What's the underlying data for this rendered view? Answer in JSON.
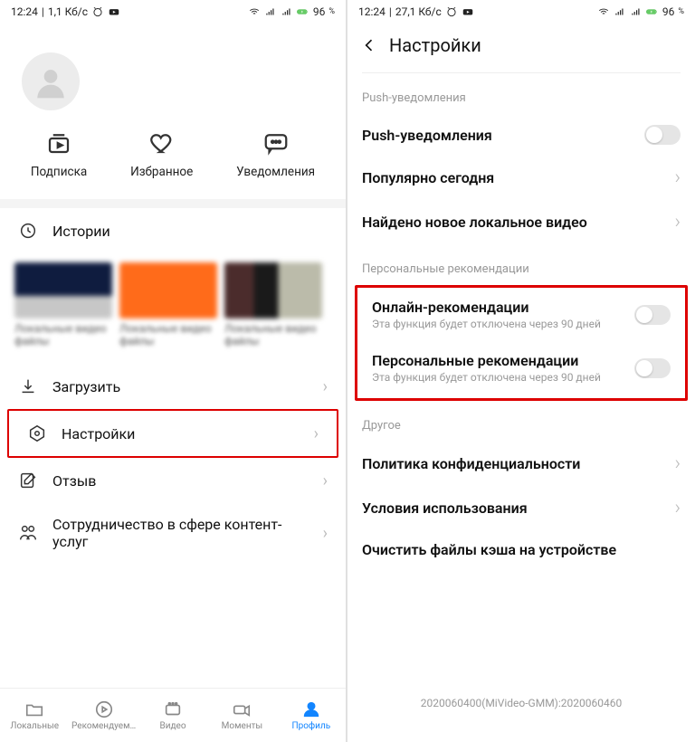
{
  "left": {
    "status": {
      "time": "12:24",
      "rate": "1,1 Кб/с",
      "battery_pct": "96",
      "pct_suffix": "%"
    },
    "quick": {
      "subs": "Подписка",
      "fav": "Избранное",
      "notif": "Уведомления"
    },
    "history_label": "Истории",
    "thumb_caps": [
      "Локальные видео файлы",
      "Локальные видео файлы",
      "Локальные видео файлы"
    ],
    "rows": {
      "download": "Загрузить",
      "settings": "Настройки",
      "feedback": "Отзыв",
      "partner": "Сотрудничество в сфере контент-услуг"
    },
    "nav": {
      "local": "Локальные",
      "recommend": "Рекомендуем…",
      "video": "Видео",
      "moments": "Моменты",
      "profile": "Профиль"
    }
  },
  "right": {
    "status": {
      "time": "12:24",
      "rate": "27,1 Кб/с",
      "battery_pct": "96",
      "pct_suffix": "%"
    },
    "title": "Настройки",
    "section_push": "Push-уведомления",
    "rows": {
      "push": "Push-уведомления",
      "popular": "Популярно сегодня",
      "found": "Найдено новое локальное видео"
    },
    "section_personal": "Персональные рекомендации",
    "personal": {
      "online_t": "Онлайн-рекомендации",
      "online_s": "Эта функция будет отключена через 90 дней",
      "personal_t": "Персональные рекомендации",
      "personal_s": "Эта функция будет отключена через 90 дней"
    },
    "section_other": "Другое",
    "other": {
      "privacy": "Политика конфиденциальности",
      "terms": "Условия использования",
      "cache": "Очистить файлы кэша на устройстве"
    },
    "build": "2020060400(MiVideo-GMM):2020060460"
  }
}
